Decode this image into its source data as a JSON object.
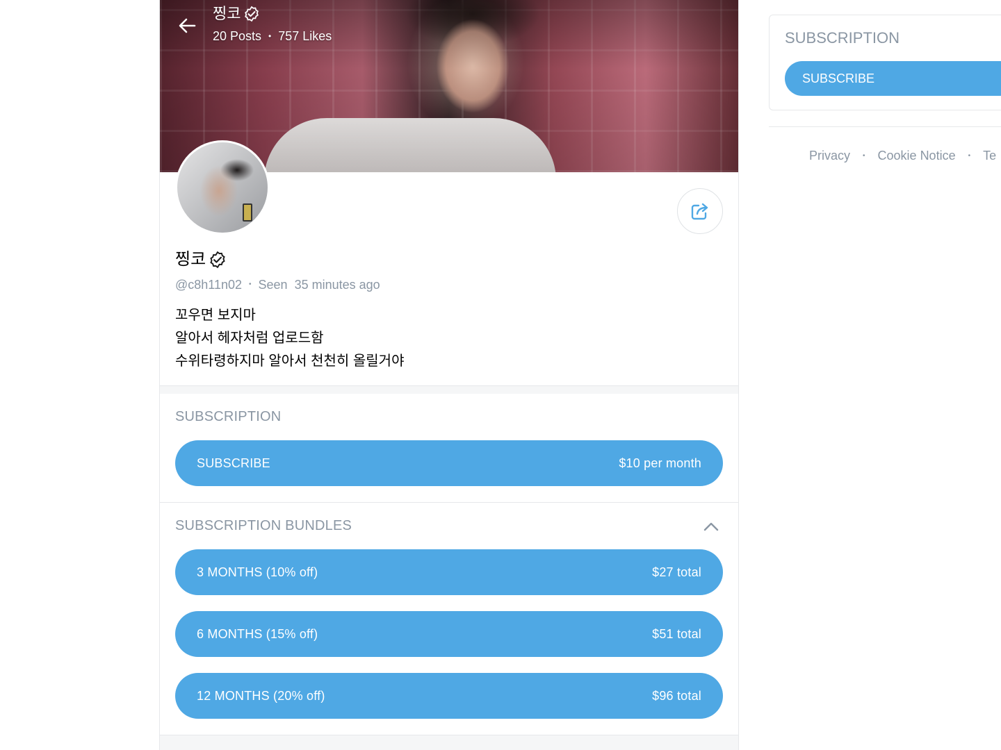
{
  "header": {
    "name": "찡코",
    "stats": {
      "posts": "20 Posts",
      "likes": "757 Likes"
    }
  },
  "profile": {
    "name": "찡코",
    "handle": "@c8h11n02",
    "seen_label": "Seen",
    "seen_time": "35 minutes ago",
    "bio": [
      "꼬우면 보지마",
      "알아서 헤자처럼 업로드함",
      "수위타령하지마 알아서 천천히 올릴거야"
    ]
  },
  "subscription": {
    "title": "SUBSCRIPTION",
    "button_label": "SUBSCRIBE",
    "price": "$10 per month"
  },
  "bundles": {
    "title": "SUBSCRIPTION BUNDLES",
    "items": [
      {
        "label": "3 MONTHS (10% off)",
        "price": "$27 total"
      },
      {
        "label": "6 MONTHS (15% off)",
        "price": "$51 total"
      },
      {
        "label": "12 MONTHS (20% off)",
        "price": "$96 total"
      }
    ]
  },
  "sidebar": {
    "title": "SUBSCRIPTION",
    "button_label": "SUBSCRIBE",
    "footer_links": [
      "Privacy",
      "Cookie Notice",
      "Te"
    ]
  },
  "icons": [
    "back-arrow-icon",
    "verified-badge-icon",
    "share-icon",
    "chevron-up-icon"
  ],
  "colors": {
    "accent": "#4fa8e4",
    "muted_text": "#8a96a3",
    "border": "#e6e8ea"
  }
}
